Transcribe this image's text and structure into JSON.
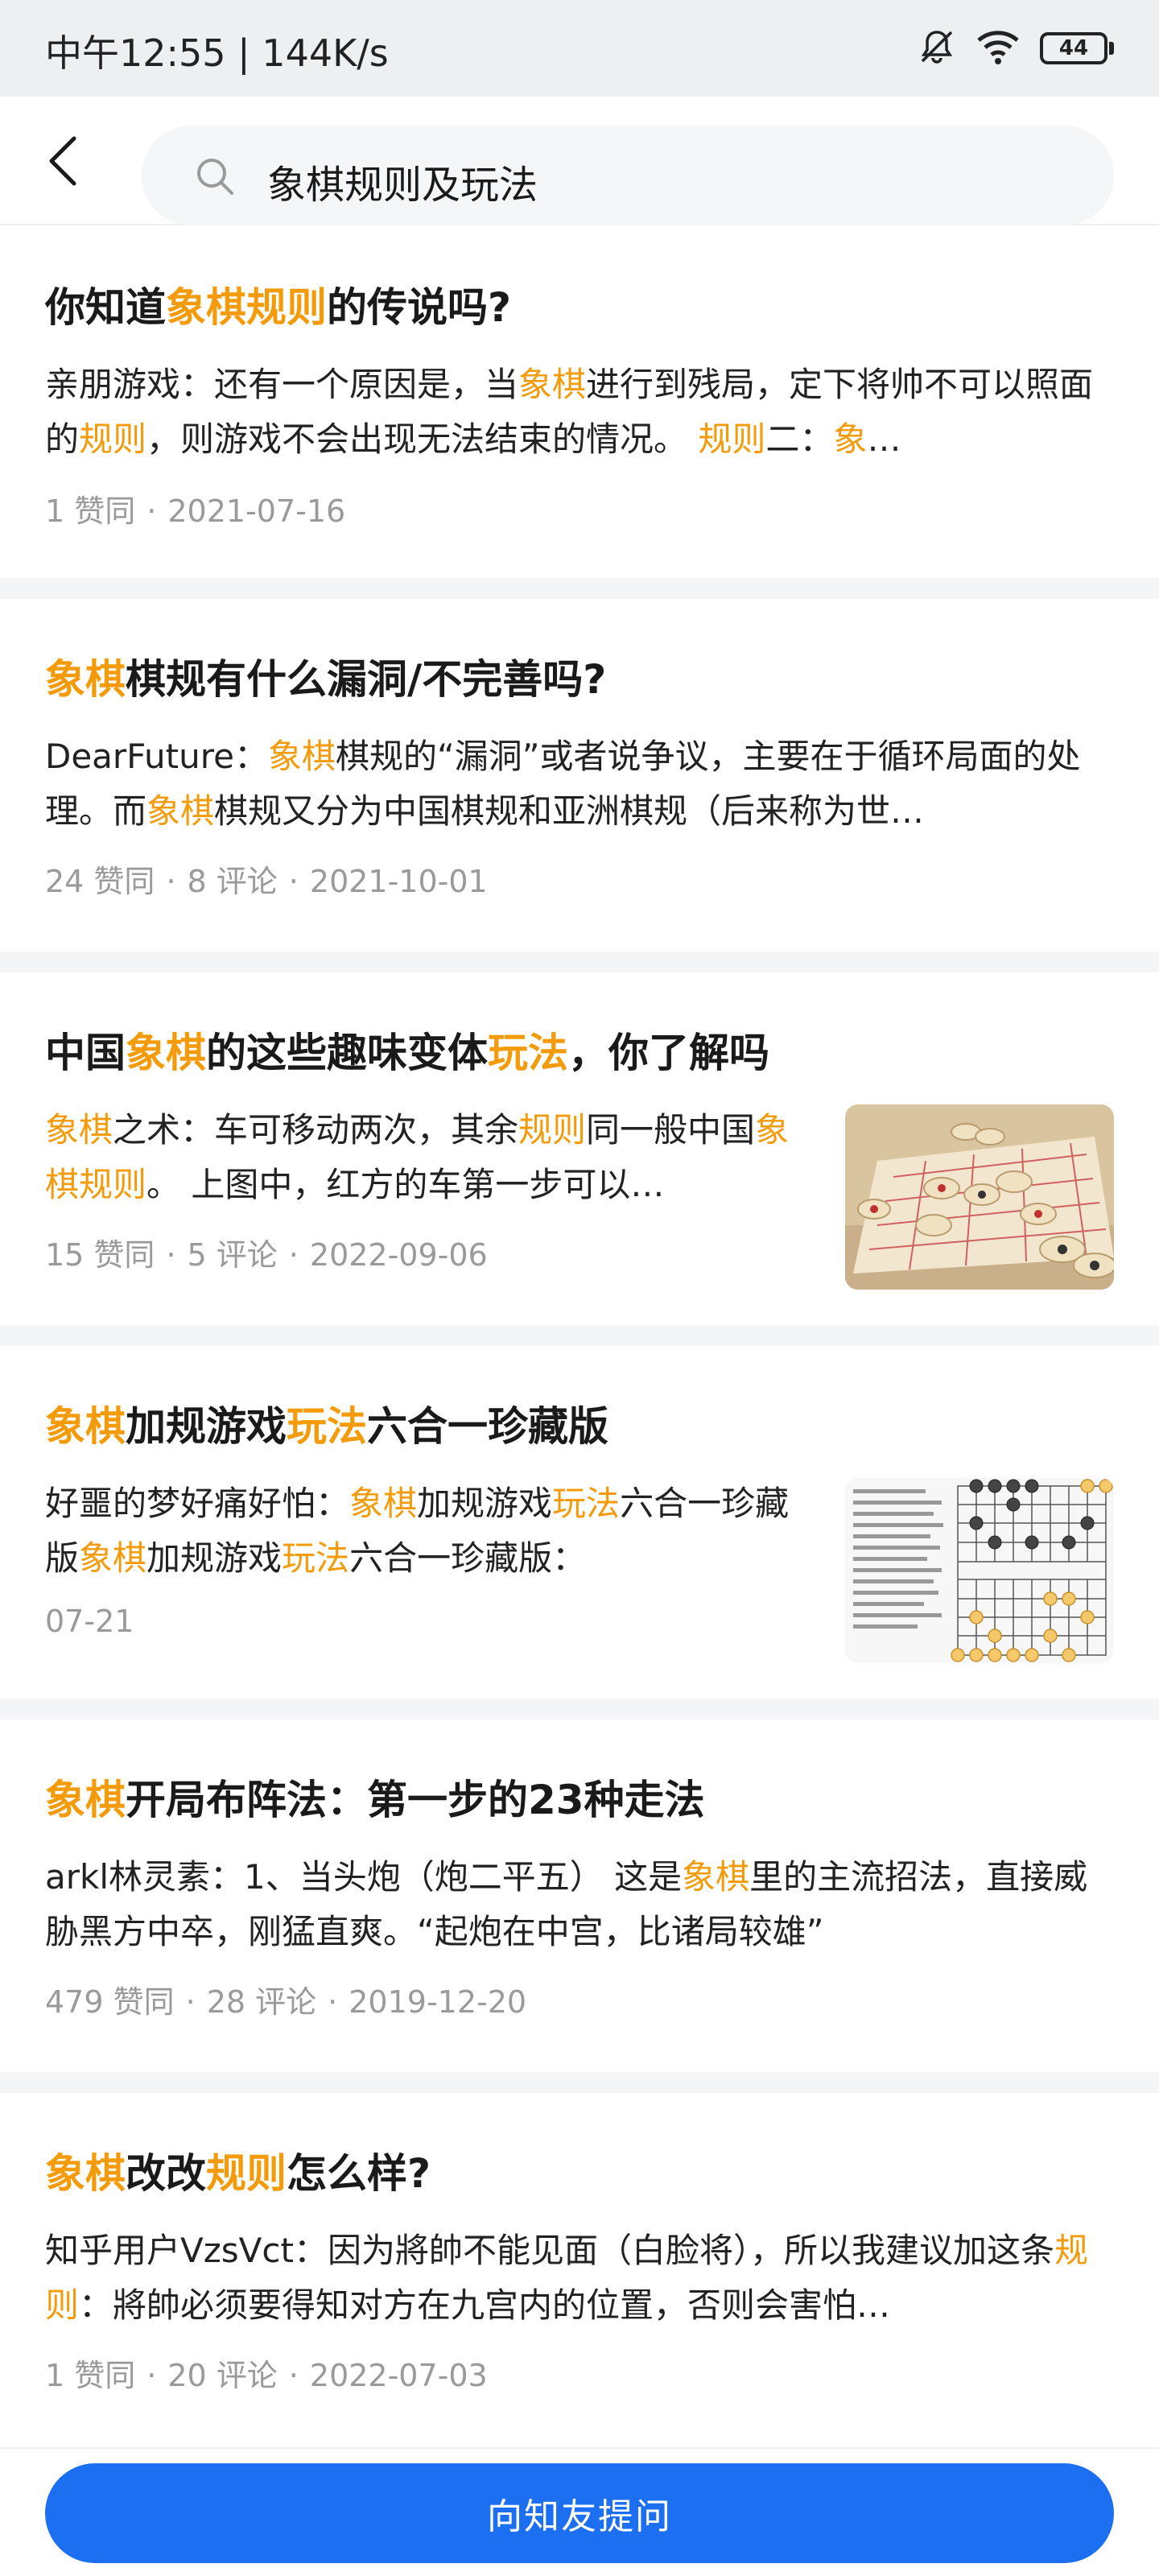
{
  "status_bar": {
    "time": "中午12:55 | 144K/s",
    "battery": "44",
    "icons": [
      "mute-bell-icon",
      "wifi-icon",
      "battery-icon"
    ]
  },
  "header": {
    "search_query": "象棋规则及玩法"
  },
  "colors": {
    "highlight": "#f49b0c",
    "accent": "#1d6ff2",
    "meta": "#9a9a9a"
  },
  "results": [
    {
      "title": [
        "你知道",
        "象棋规则",
        "的传说吗?"
      ],
      "body": [
        "亲朋游戏：还有一个原因是，当",
        "象棋",
        "进行到残局，定下将帅不可以照面的",
        "规则",
        "，则游戏不会出现无法结束的情况。 ",
        "规则",
        "二：",
        "象",
        "…"
      ],
      "likes": "1 赞同",
      "comments": "",
      "date": "2021-07-16"
    },
    {
      "title": [
        "",
        "象棋",
        "棋规有什么漏洞/不完善吗?"
      ],
      "body": [
        "DearFuture：",
        "象棋",
        "棋规的“漏洞”或者说争议，主要在于循环局面的处理。而",
        "象棋",
        "棋规又分为中国棋规和亚洲棋规（后来称为世…"
      ],
      "likes": "24 赞同",
      "comments": "8 评论",
      "date": "2021-10-01"
    },
    {
      "title": [
        "中国",
        "象棋",
        "的这些趣味变体",
        "玩法",
        "，你了解吗"
      ],
      "body": [
        "",
        "象棋",
        "之术：车可移动两次，其余",
        "规则",
        "同一般中国",
        "象棋规则",
        "。 上图中，红方的车第一步可以…"
      ],
      "likes": "15 赞同",
      "comments": "5 评论",
      "date": "2022-09-06",
      "thumbnail": "chess-board-photo"
    },
    {
      "title": [
        "",
        "象棋",
        "加规游戏",
        "玩法",
        "六合一珍藏版"
      ],
      "body": [
        "好噩的梦好痛好怕：",
        "象棋",
        "加规游戏",
        "玩法",
        "六合一珍藏版",
        "象棋",
        "加规游戏",
        "玩法",
        "六合一珍藏版："
      ],
      "likes": "",
      "comments": "",
      "date": "07-21",
      "thumbnail": "chess-diagram"
    },
    {
      "title": [
        "",
        "象棋",
        "开局布阵法：第一步的23种走法"
      ],
      "body": [
        "arkl林灵素：1、当头炮（炮二平五） 这是",
        "象棋",
        "里的主流招法，直接威胁黑方中卒，刚猛直爽。“起炮在中宫，比诸局较雄”"
      ],
      "likes": "479 赞同",
      "comments": "28 评论",
      "date": "2019-12-20"
    },
    {
      "title": [
        "",
        "象棋",
        "改改",
        "规则",
        "怎么样?"
      ],
      "body": [
        "知乎用户VzsVct：因为將帥不能见面（白脸将），所以我建议加这条",
        "规则",
        "：將帥必须要得知对方在九宫内的位置，否则会害怕…"
      ],
      "likes": "1 赞同",
      "comments": "20 评论",
      "date": "2022-07-03"
    }
  ],
  "bottom_bar": {
    "ask_button": "向知友提问"
  }
}
